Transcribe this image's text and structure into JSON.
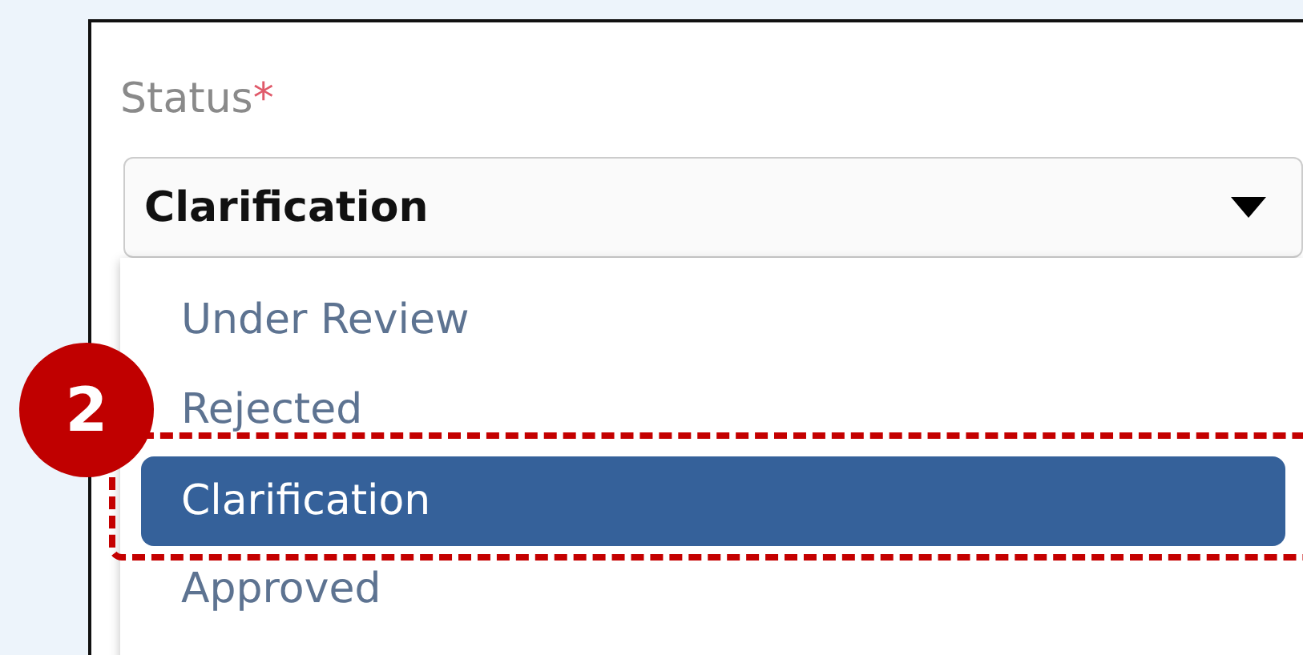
{
  "field": {
    "label": "Status",
    "required_mark": "*",
    "value": "Clarification",
    "expanded": true
  },
  "options": [
    {
      "label": "Under Review",
      "selected": false
    },
    {
      "label": "Rejected",
      "selected": false
    },
    {
      "label": "Clarification",
      "selected": true
    },
    {
      "label": "Approved",
      "selected": false
    }
  ],
  "callout": {
    "number": "2"
  }
}
